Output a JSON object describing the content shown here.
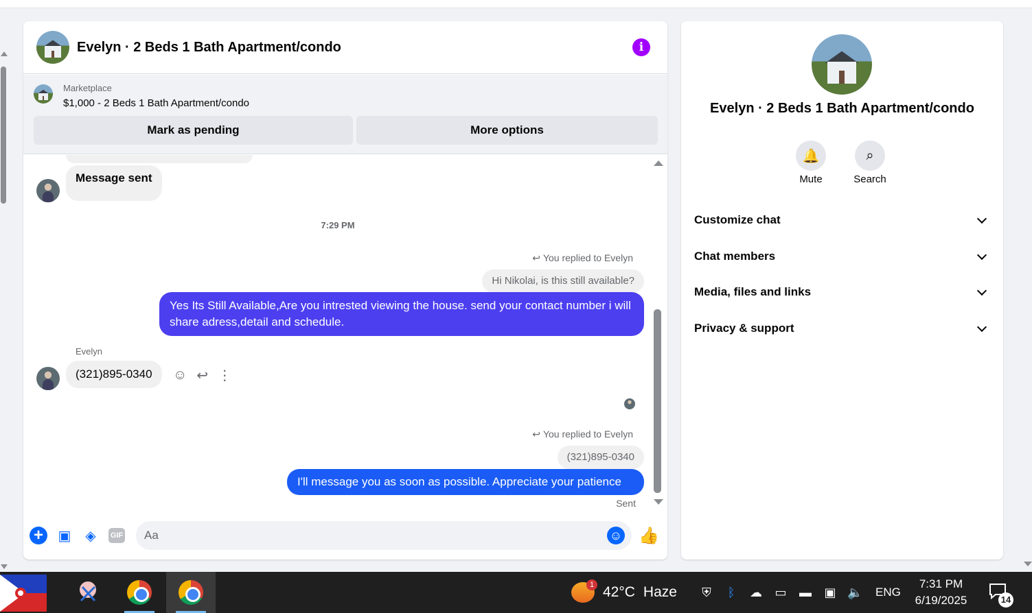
{
  "chat": {
    "title": "Evelyn · 2 Beds 1 Bath Apartment/condo",
    "marketplace_label": "Marketplace",
    "listing": "$1,000 - 2 Beds 1 Bath Apartment/condo",
    "mark_pending_label": "Mark as pending",
    "more_options_label": "More options",
    "accent_color": "#a100ff"
  },
  "messages": {
    "first_incoming": "Message sent",
    "time_separator": "7:29 PM",
    "reply1": {
      "note": "You replied to Evelyn",
      "quoted": "Hi Nikolai, is this still available?",
      "text": "Yes Its Still Available,Are you intrested viewing the house. send your contact number i will share adress,detail and schedule.",
      "color": "#4c3ff0"
    },
    "incoming_sender": "Evelyn",
    "incoming_phone": "(321)895-0340",
    "reply2": {
      "note": "You replied to Evelyn",
      "quoted": "(321)895-0340",
      "text": "I'll message you as soon as possible. Appreciate your patience",
      "color": "#1a5cf5"
    },
    "status": "Sent"
  },
  "composer": {
    "placeholder": "Aa",
    "icons": [
      "plus-icon",
      "image-icon",
      "sticker-icon",
      "gif-icon",
      "emoji-icon",
      "like-icon"
    ],
    "gif_label": "GIF"
  },
  "details": {
    "name": "Evelyn · 2 Beds 1 Bath Apartment/condo",
    "mute_label": "Mute",
    "search_label": "Search",
    "sections": [
      "Customize chat",
      "Chat members",
      "Media, files and links",
      "Privacy & support"
    ]
  },
  "taskbar": {
    "weather_badge": "1",
    "temperature": "42°C",
    "condition": "Haze",
    "language": "ENG",
    "time": "7:31 PM",
    "date": "6/19/2025",
    "notifications": "14"
  }
}
